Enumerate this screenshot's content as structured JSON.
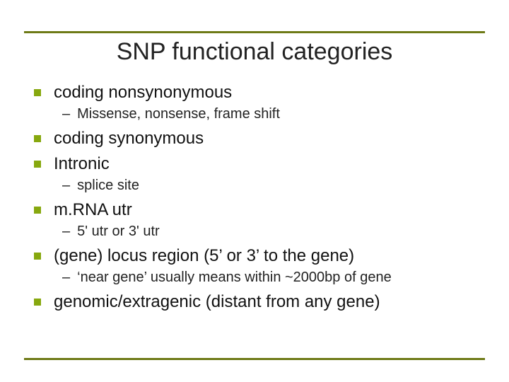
{
  "title": "SNP functional categories",
  "items": {
    "i0": {
      "text": "coding nonsynonymous"
    },
    "i0s0": {
      "text": "Missense, nonsense, frame shift"
    },
    "i1": {
      "text": "coding synonymous"
    },
    "i2": {
      "text": "Intronic"
    },
    "i2s0": {
      "text": "splice site"
    },
    "i3": {
      "text": "m.RNA utr"
    },
    "i3s0": {
      "text": "5' utr or 3' utr"
    },
    "i4": {
      "text": "(gene) locus region (5’ or 3’ to the gene)"
    },
    "i4s0": {
      "text": " ‘near gene’ usually means within ~2000bp of gene"
    },
    "i5": {
      "text": "genomic/extragenic (distant from any gene)"
    }
  },
  "dash": "–"
}
